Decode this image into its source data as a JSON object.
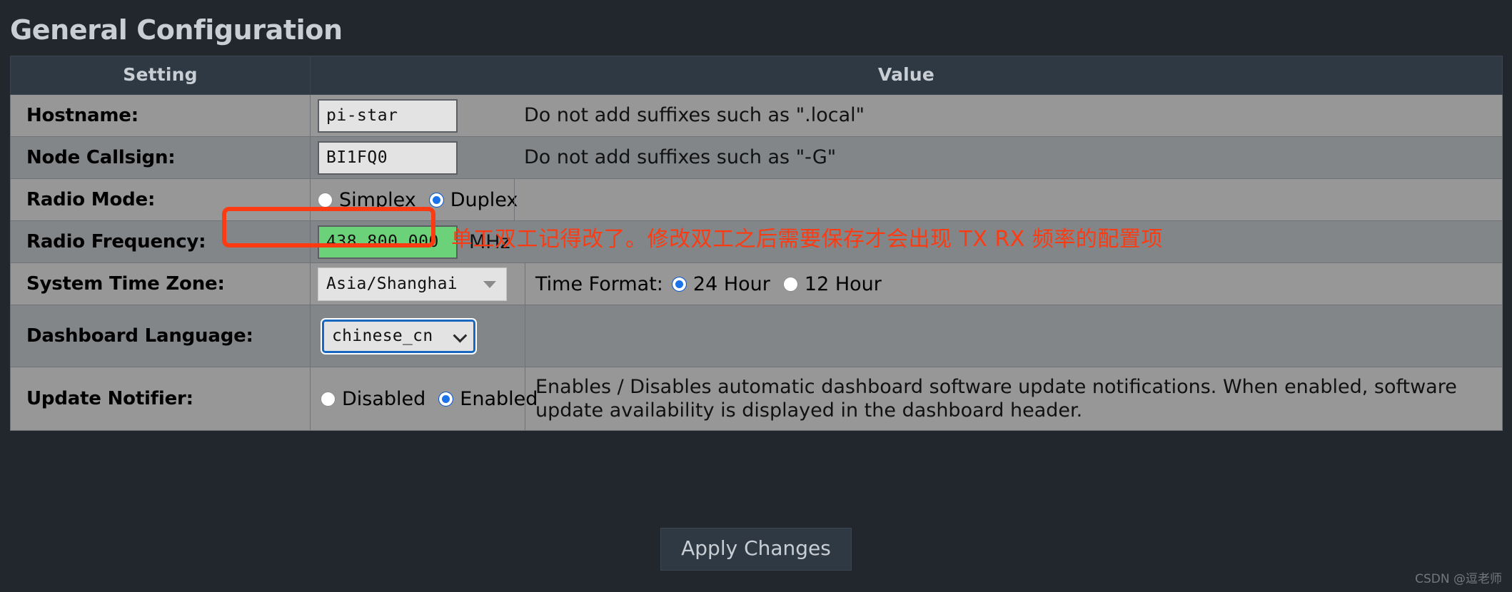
{
  "page": {
    "title": "General Configuration",
    "watermark": "CSDN @逗老师",
    "apply_button": "Apply Changes",
    "accent_red": "#fc3b12",
    "accent_blue": "#1a73e8",
    "accent_green": "#6cd279",
    "row_bg_light": "#979797",
    "row_bg_dark": "#838689",
    "header_bg": "#2f3944",
    "page_bg": "#22272e"
  },
  "table": {
    "columns": [
      "Setting",
      "Value"
    ],
    "rows": {
      "hostname": {
        "label": "Hostname:",
        "input_value": "pi-star",
        "help": "Do not add suffixes such as \".local\""
      },
      "node_callsign": {
        "label": "Node Callsign:",
        "input_value": "BI1FQ0",
        "help": "Do not add suffixes such as \"-G\""
      },
      "radio_mode": {
        "label": "Radio Mode:",
        "options": [
          "Simplex",
          "Duplex"
        ],
        "selected": "Duplex"
      },
      "radio_frequency": {
        "label": "Radio Frequency:",
        "input_value": "438.800.000",
        "unit": "MHz"
      },
      "system_time_zone": {
        "label": "System Time Zone:",
        "selected": "Asia/Shanghai",
        "time_format_label": "Time Format:",
        "time_format_options": [
          "24 Hour",
          "12 Hour"
        ],
        "time_format_selected": "24 Hour"
      },
      "dashboard_language": {
        "label": "Dashboard Language:",
        "selected": "chinese_cn"
      },
      "update_notifier": {
        "label": "Update Notifier:",
        "options": [
          "Disabled",
          "Enabled"
        ],
        "selected": "Enabled",
        "help": "Enables / Disables automatic dashboard software update notifications. When enabled, software update availability is displayed in the dashboard header."
      }
    }
  },
  "annotation": {
    "text": "单工双工记得改了。修改双工之后需要保存才会出现 TX RX 频率的配置项"
  }
}
